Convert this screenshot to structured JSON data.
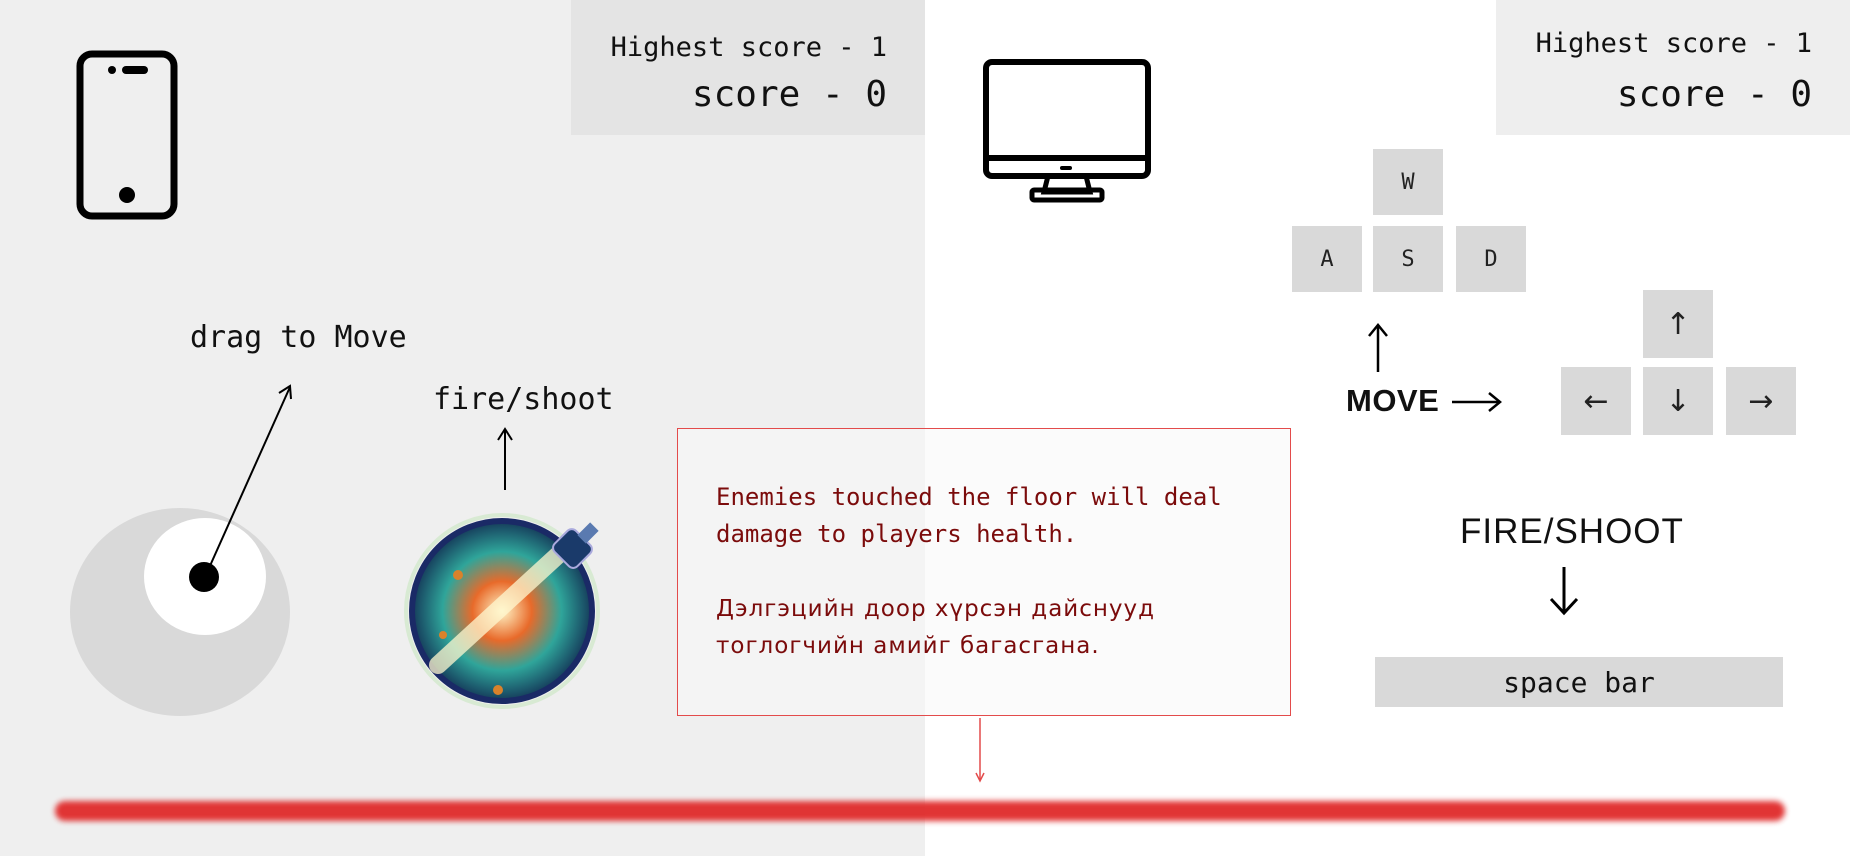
{
  "mobile": {
    "icon": "smartphone-icon",
    "highest_score": "Highest score - 1",
    "score": "score - 0",
    "drag_label": "drag to Move",
    "fire_label": "fire/shoot",
    "joystick": "virtual-joystick",
    "fire_button_icon": "spaceship-orb-icon"
  },
  "notice": {
    "english": "Enemies touched the floor will deal damage to players health.",
    "mongolian": "Дэлгэцийн доор хүрсэн дайснууд тоглогчийн амийг багасгана.",
    "color": "#7b0b0b",
    "border_color": "#e34b4b"
  },
  "desktop": {
    "icon": "desktop-monitor-icon",
    "highest_score": "Highest score - 1",
    "score": "score - 0",
    "keys": {
      "w": "W",
      "a": "A",
      "s": "S",
      "d": "D"
    },
    "arrow_keys": {
      "up": "↑",
      "left": "←",
      "down": "↓",
      "right": "→"
    },
    "move_label": "MOVE",
    "fire_label": "FIRE/SHOOT",
    "spacebar_label": "space bar"
  },
  "floor": {
    "color": "#e02a2a"
  }
}
